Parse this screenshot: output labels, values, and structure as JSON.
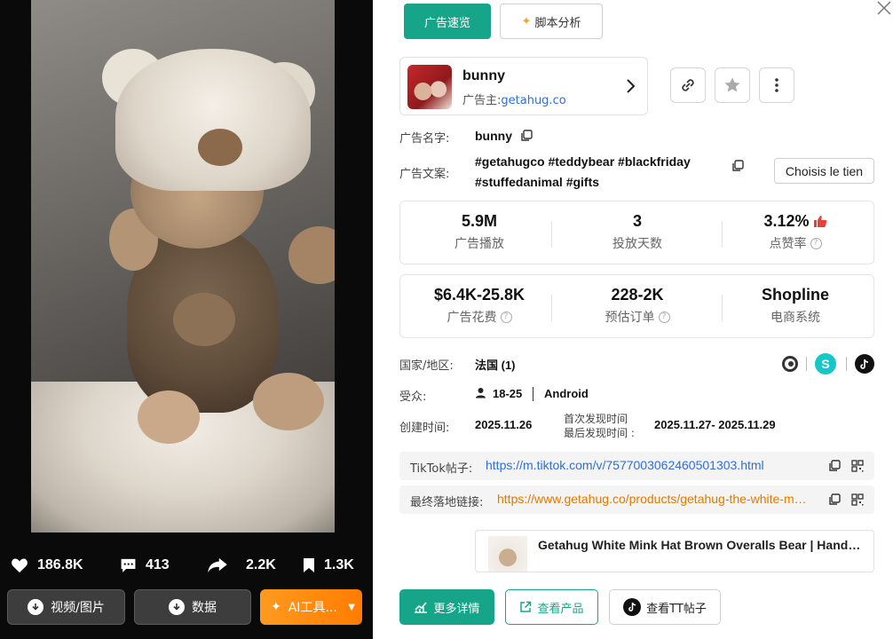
{
  "video": {
    "likes": "186.8K",
    "comments": "413",
    "shares": "2.2K",
    "saves": "1.3K"
  },
  "left_actions": {
    "media_label": "视频/图片",
    "data_label": "数据",
    "ai_label": "AI工具..."
  },
  "tabs": {
    "overview": "广告速览",
    "script_analysis": "脚本分析"
  },
  "ad": {
    "name": "bunny",
    "owner_prefix": "广告主:",
    "owner_link": "getahug.co"
  },
  "fields": {
    "ad_name_label": "广告名字:",
    "ad_name_value": "bunny",
    "ad_copy_label": "广告文案:",
    "ad_copy_line1": "#getahugco #teddybear #blackfriday",
    "ad_copy_line2": "#stuffedanimal #gifts",
    "choose_button": "Choisis le tien",
    "country_label": "国家/地区:",
    "country_value": "法国 (1)",
    "audience_label": "受众:",
    "audience_age": "18-25",
    "audience_os": "Android",
    "created_label": "创建时间:",
    "created_value": "2025.11.26",
    "first_seen_label": "首次发现时间",
    "last_seen_label": "最后发现时间 :",
    "seen_range": "2025.11.27- 2025.11.29"
  },
  "metrics_row1": [
    {
      "value": "5.9M",
      "label": "广告播放"
    },
    {
      "value": "3",
      "label": "投放天数"
    },
    {
      "value": "3.12%",
      "label": "点赞率"
    }
  ],
  "metrics_row2": [
    {
      "value": "$6.4K-25.8K",
      "label": "广告花费"
    },
    {
      "value": "228-2K",
      "label": "预估订单"
    },
    {
      "value": "Shopline",
      "label": "电商系统"
    }
  ],
  "links": {
    "tiktok_label": "TikTok帖子:",
    "tiktok_url": "https://m.tiktok.com/v/7577003062460501303.html",
    "landing_label": "最终落地链接:",
    "landing_url": "https://www.getahug.co/products/getahug-the-white-mink-hat-brown-overalls-bear"
  },
  "product": {
    "title": "Getahug White Mink Hat Brown Overalls Bear | Handmade"
  },
  "bottom_actions": {
    "more_details": "更多详情",
    "view_product": "查看产品",
    "view_tt": "查看TT帖子"
  },
  "colors": {
    "accent": "#17a589",
    "link_blue": "#2f6fd6",
    "link_orange": "#e07a00",
    "like_red": "#e8403a",
    "ai_orange": "#ff8a00"
  }
}
